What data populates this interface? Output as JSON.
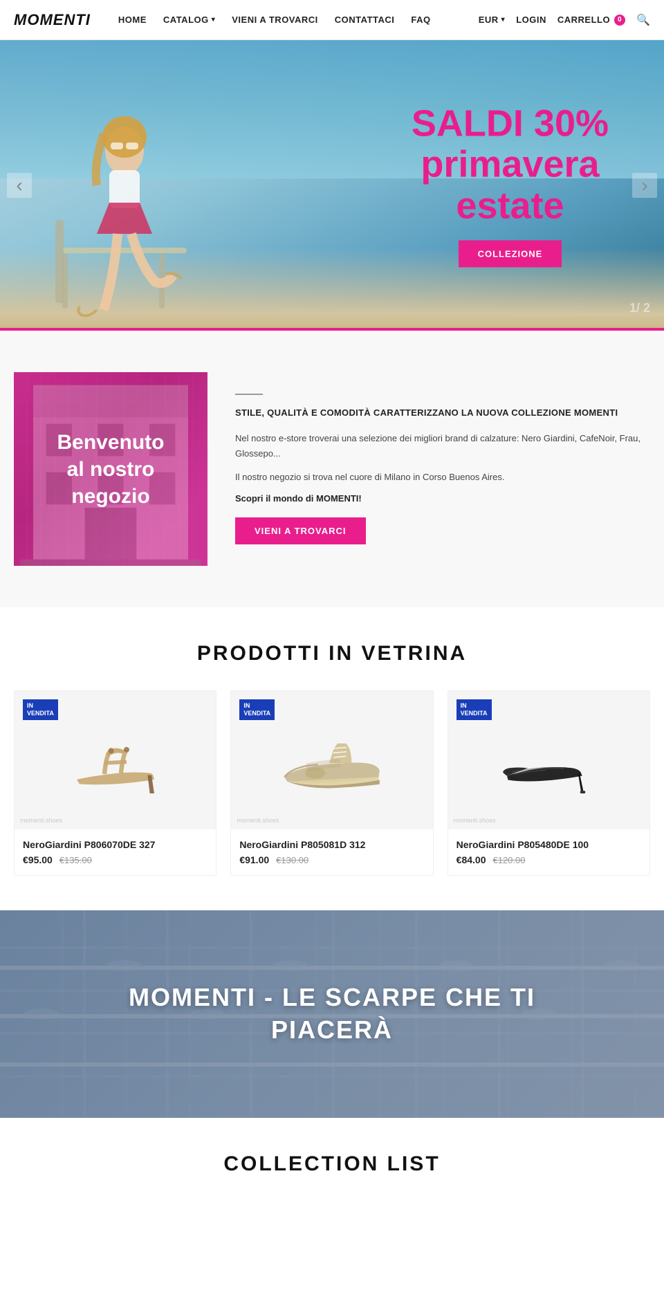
{
  "header": {
    "logo": "MOMENTI",
    "nav": [
      {
        "label": "HOME",
        "hasDropdown": false
      },
      {
        "label": "CATALOG",
        "hasDropdown": true
      },
      {
        "label": "VIENI A TROVARCI",
        "hasDropdown": false
      },
      {
        "label": "CONTATTACI",
        "hasDropdown": false
      },
      {
        "label": "FAQ",
        "hasDropdown": false
      },
      {
        "label": "EUR",
        "hasDropdown": true
      },
      {
        "label": "LOGIN",
        "hasDropdown": false
      },
      {
        "label": "CARRELLO",
        "hasDropdown": false,
        "badge": "0"
      }
    ]
  },
  "hero": {
    "title_line1": "SALDI 30%",
    "title_line2": "primavera",
    "title_line3": "estate",
    "cta_label": "COLLEZIONE",
    "slide_current": "1",
    "slide_total": "/ 2"
  },
  "about": {
    "image_text_line1": "Benvenuto",
    "image_text_line2": "al nostro",
    "image_text_line3": "negozio",
    "title": "STILE, QUALITÀ E COMODITÀ CARATTERIZZANO LA NUOVA COLLEZIONE MOMENTI",
    "desc1": "Nel nostro e-store troverai una selezione dei migliori brand di calzature: Nero Giardini, CafeNoir, Frau, Glossepo...",
    "desc2": "Il nostro negozio si trova nel cuore di Milano in Corso Buenos Aires.",
    "discover": "Scopri il mondo di MOMENTI!",
    "btn_label": "VIENI A TROVARCI"
  },
  "products": {
    "section_title": "PRODOTTI IN VETRINA",
    "items": [
      {
        "badge": "IN\nVENDITA",
        "name": "NeroGiardini P806070DE 327",
        "price": "€95.00",
        "original_price": "€135.00",
        "watermark": "momenti.shoes",
        "type": "sandal"
      },
      {
        "badge": "IN\nVENDITA",
        "name": "NeroGiardini P805081D 312",
        "price": "€91.00",
        "original_price": "€130.00",
        "watermark": "momenti.shoes",
        "type": "sneaker"
      },
      {
        "badge": "IN\nVENDITA",
        "name": "NeroGiardini P805480DE 100",
        "price": "€84.00",
        "original_price": "€120.00",
        "watermark": "momenti.shoes",
        "type": "pump"
      }
    ]
  },
  "banner": {
    "title_line1": "MOMENTI - LE SCARPE CHE TI",
    "title_line2": "PIACERÀ"
  },
  "collection": {
    "title": "COLLECTION LIST"
  }
}
